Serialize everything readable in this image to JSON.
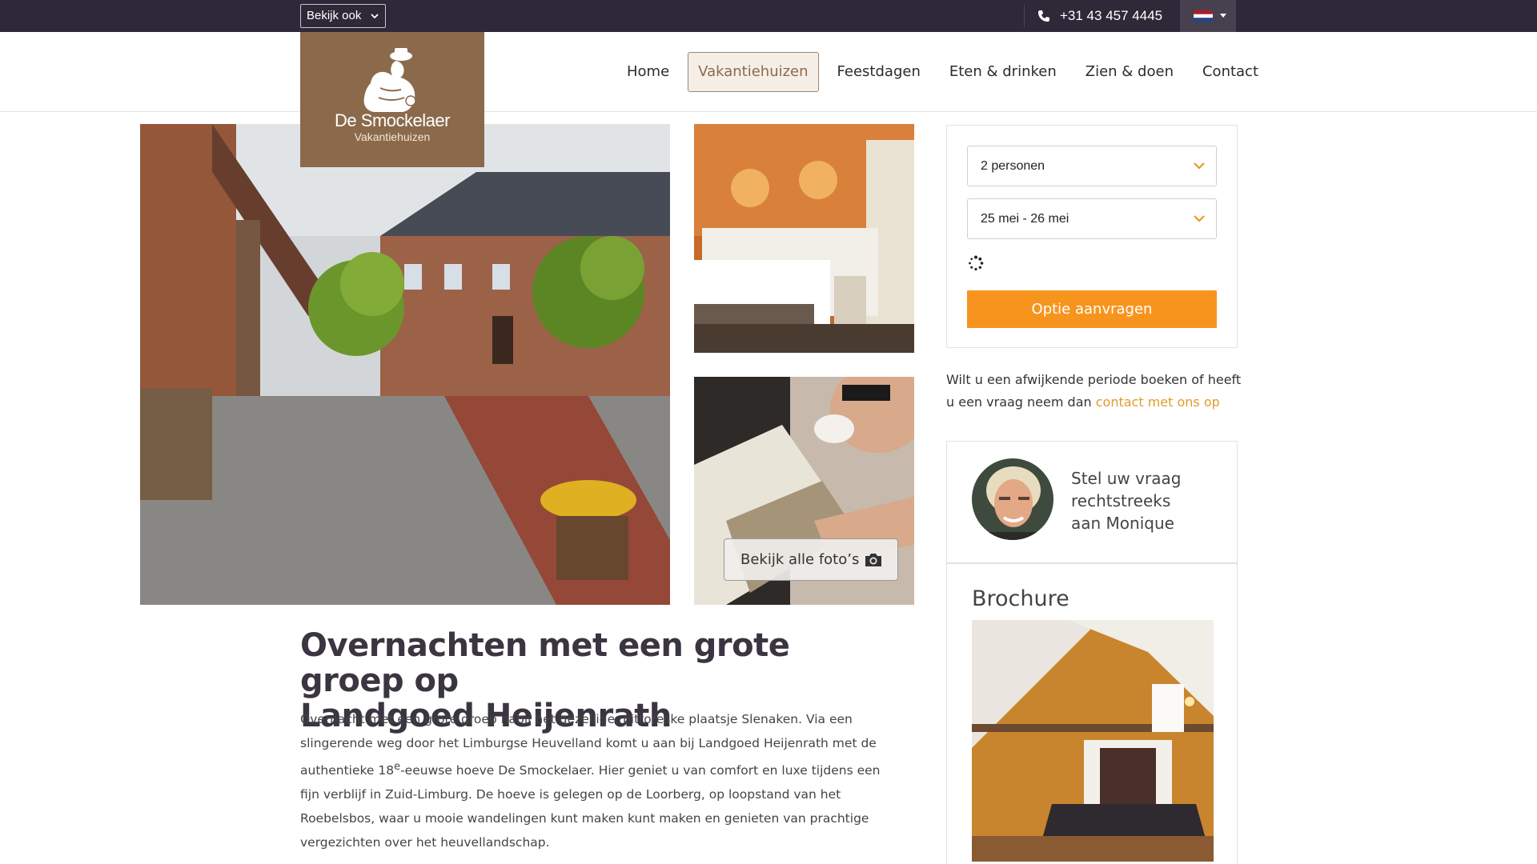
{
  "topbar": {
    "dropdown_label": "Bekijk ook",
    "phone": "+31 43 457 4445",
    "language_flag": "nl-flag-icon"
  },
  "logo": {
    "title": "De Smockelaer",
    "subtitle": "Vakantiehuizen"
  },
  "nav": {
    "items": [
      {
        "label": "Home",
        "active": false
      },
      {
        "label": "Vakantiehuizen",
        "active": true
      },
      {
        "label": "Feestdagen",
        "active": false
      },
      {
        "label": "Eten & drinken",
        "active": false
      },
      {
        "label": "Zien & doen",
        "active": false
      },
      {
        "label": "Contact",
        "active": false
      }
    ]
  },
  "gallery": {
    "all_photos_label": "Bekijk alle foto’s"
  },
  "booking": {
    "persons_value": "2 personen",
    "dates_value": "25 mei - 26 mei",
    "submit_label": "Optie aanvragen"
  },
  "alt_booking": {
    "text": "Wilt u een afwijkende periode boeken of heeft u een vraag neem dan ",
    "link": "contact met ons op"
  },
  "contact": {
    "line1": "Stel uw vraag",
    "line2": "rechtstreeks",
    "line3": "aan Monique"
  },
  "brochure": {
    "title": "Brochure"
  },
  "article": {
    "title_line1": "Overnachten met een grote groep op",
    "title_line2": "Landgoed Heijenrath",
    "body_part1": "Overnacht met een grote groep nabij het gezellige, pittoreske plaatsje Slenaken. Via een slingerende weg door het Limburgse Heuvelland komt u aan bij Landgoed Heijenrath met de authentieke 18",
    "body_sup": "e",
    "body_part2": "-eeuwse hoeve De Smockelaer. Hier geniet u van comfort en luxe tijdens een fijn verblijf in Zuid-Limburg. De hoeve is gelegen op de Loorberg, op loopstand van het Roebelsbos, waar u mooie wandelingen kunt maken kunt maken en genieten van prachtige vergezichten over het heuvellandschap."
  },
  "colors": {
    "topbar": "#2e2838",
    "brand_brown": "#8b6a4b",
    "accent_orange": "#f7941d",
    "link_orange": "#e39a2c"
  }
}
